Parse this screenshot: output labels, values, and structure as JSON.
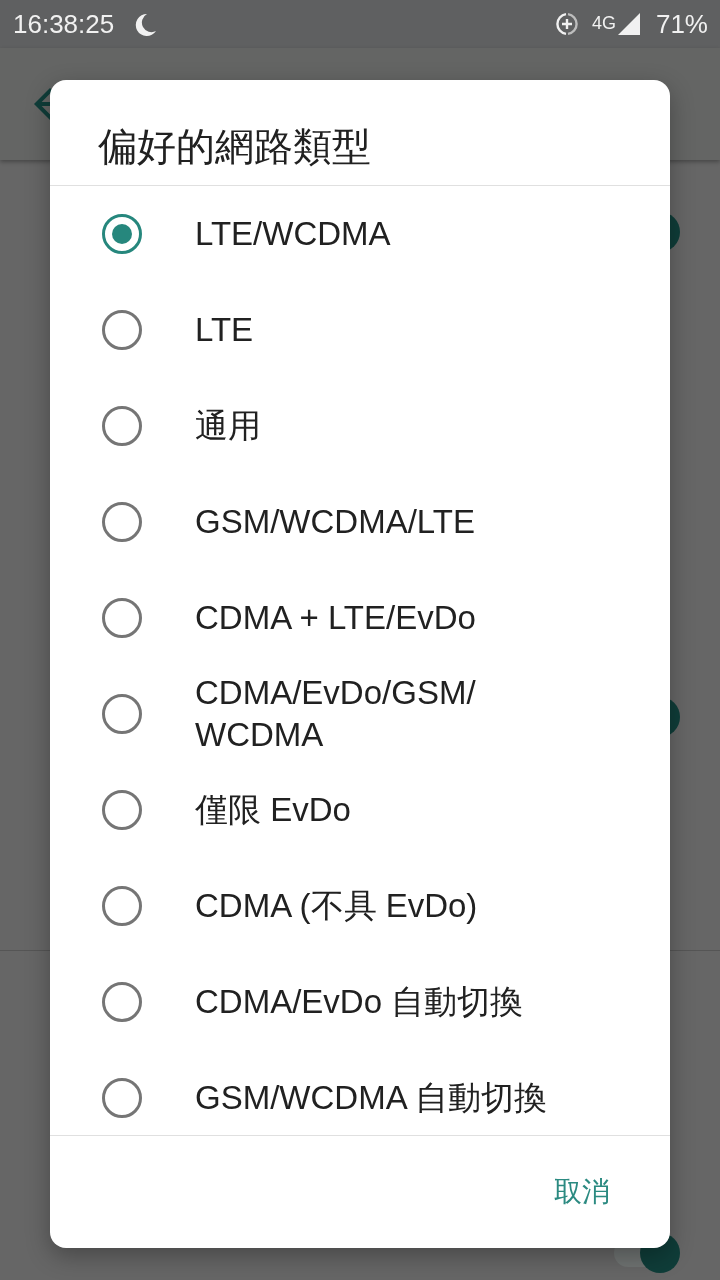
{
  "status_bar": {
    "time": "16:38:25",
    "network": "4G",
    "battery": "71%"
  },
  "background": {
    "switches": [
      {
        "on": true
      },
      {
        "on": true
      },
      {
        "on": true
      }
    ]
  },
  "dialog": {
    "title": "偏好的網路類型",
    "options": [
      {
        "label": "LTE/WCDMA",
        "selected": true
      },
      {
        "label": "LTE",
        "selected": false
      },
      {
        "label": "通用",
        "selected": false
      },
      {
        "label": "GSM/WCDMA/LTE",
        "selected": false
      },
      {
        "label": "CDMA + LTE/EvDo",
        "selected": false
      },
      {
        "label": "CDMA/EvDo/GSM/WCDMA",
        "selected": false
      },
      {
        "label": "僅限 EvDo",
        "selected": false
      },
      {
        "label": "CDMA (不具 EvDo)",
        "selected": false
      },
      {
        "label": "CDMA/EvDo 自動切換",
        "selected": false
      },
      {
        "label": "GSM/WCDMA 自動切換",
        "selected": false
      }
    ],
    "buttons": [
      {
        "label": "取消"
      }
    ]
  }
}
